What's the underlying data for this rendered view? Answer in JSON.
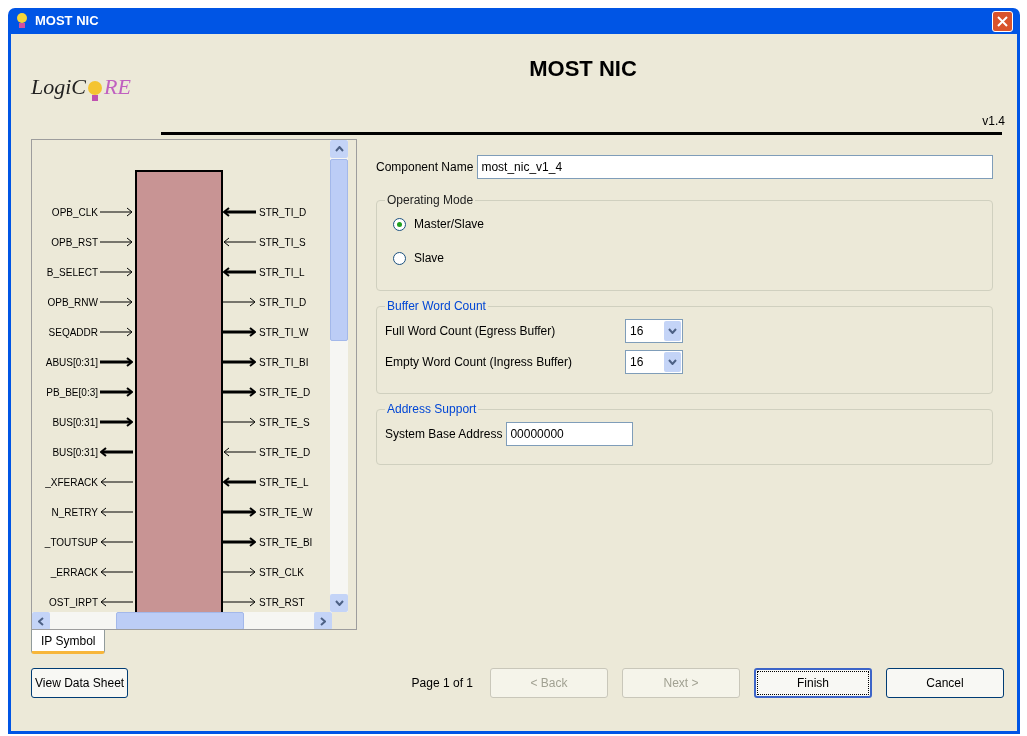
{
  "window": {
    "title": "MOST NIC"
  },
  "header": {
    "logo_left": "LogiC",
    "logo_right": "RE",
    "title": "MOST NIC",
    "version": "v1.4"
  },
  "symbol": {
    "left_pins": [
      {
        "name": "OPB_CLK",
        "kind": "input",
        "bus": false
      },
      {
        "name": "OPB_RST",
        "kind": "input",
        "bus": false
      },
      {
        "name": "B_SELECT",
        "kind": "input",
        "bus": false
      },
      {
        "name": "OPB_RNW",
        "kind": "input",
        "bus": false
      },
      {
        "name": "SEQADDR",
        "kind": "input",
        "bus": false
      },
      {
        "name": "ABUS[0:31]",
        "kind": "input",
        "bus": true
      },
      {
        "name": "PB_BE[0:3]",
        "kind": "input",
        "bus": true
      },
      {
        "name": "BUS[0:31]",
        "kind": "input",
        "bus": true
      },
      {
        "name": "BUS[0:31]",
        "kind": "output",
        "bus": true
      },
      {
        "name": "_XFERACK",
        "kind": "output",
        "bus": false
      },
      {
        "name": "N_RETRY",
        "kind": "output",
        "bus": false
      },
      {
        "name": "_TOUTSUP",
        "kind": "output",
        "bus": false
      },
      {
        "name": "_ERRACK",
        "kind": "output",
        "bus": false
      },
      {
        "name": "OST_IRPT",
        "kind": "output",
        "bus": false
      }
    ],
    "right_pins": [
      {
        "name": "STR_TI_D",
        "kind": "input",
        "bus": true
      },
      {
        "name": "STR_TI_S",
        "kind": "input",
        "bus": false
      },
      {
        "name": "STR_TI_L",
        "kind": "input",
        "bus": true
      },
      {
        "name": "STR_TI_D",
        "kind": "output",
        "bus": false
      },
      {
        "name": "STR_TI_W",
        "kind": "output",
        "bus": true
      },
      {
        "name": "STR_TI_BI",
        "kind": "output",
        "bus": true
      },
      {
        "name": "STR_TE_D",
        "kind": "output",
        "bus": true
      },
      {
        "name": "STR_TE_S",
        "kind": "output",
        "bus": false
      },
      {
        "name": "STR_TE_D",
        "kind": "input",
        "bus": false
      },
      {
        "name": "STR_TE_L",
        "kind": "input",
        "bus": true
      },
      {
        "name": "STR_TE_W",
        "kind": "output",
        "bus": true
      },
      {
        "name": "STR_TE_BI",
        "kind": "output",
        "bus": true
      },
      {
        "name": "STR_CLK",
        "kind": "output",
        "bus": false
      },
      {
        "name": "STR_RST",
        "kind": "output",
        "bus": false
      }
    ]
  },
  "tabs": [
    {
      "label": "IP Symbol",
      "selected": true
    }
  ],
  "form": {
    "component_name": {
      "label": "Component Name",
      "value": "most_nic_v1_4"
    },
    "operating_mode": {
      "legend": "Operating Mode",
      "options": [
        {
          "label": "Master/Slave",
          "selected": true
        },
        {
          "label": "Slave",
          "selected": false
        }
      ]
    },
    "buffer_word_count": {
      "legend": "Buffer Word Count",
      "rows": [
        {
          "label": "Full Word Count (Egress Buffer)",
          "value": "16"
        },
        {
          "label": "Empty Word Count (Ingress Buffer)",
          "value": "16"
        }
      ]
    },
    "address_support": {
      "legend": "Address Support",
      "label": "System Base Address",
      "value": "00000000"
    }
  },
  "footer": {
    "datasheet_button": "View Data Sheet",
    "page": "Page 1 of 1",
    "buttons": [
      {
        "label": "< Back",
        "disabled": true,
        "default": false
      },
      {
        "label": "Next >",
        "disabled": true,
        "default": false
      },
      {
        "label": "Finish",
        "disabled": false,
        "default": true
      },
      {
        "label": "Cancel",
        "disabled": false,
        "default": false
      }
    ]
  }
}
